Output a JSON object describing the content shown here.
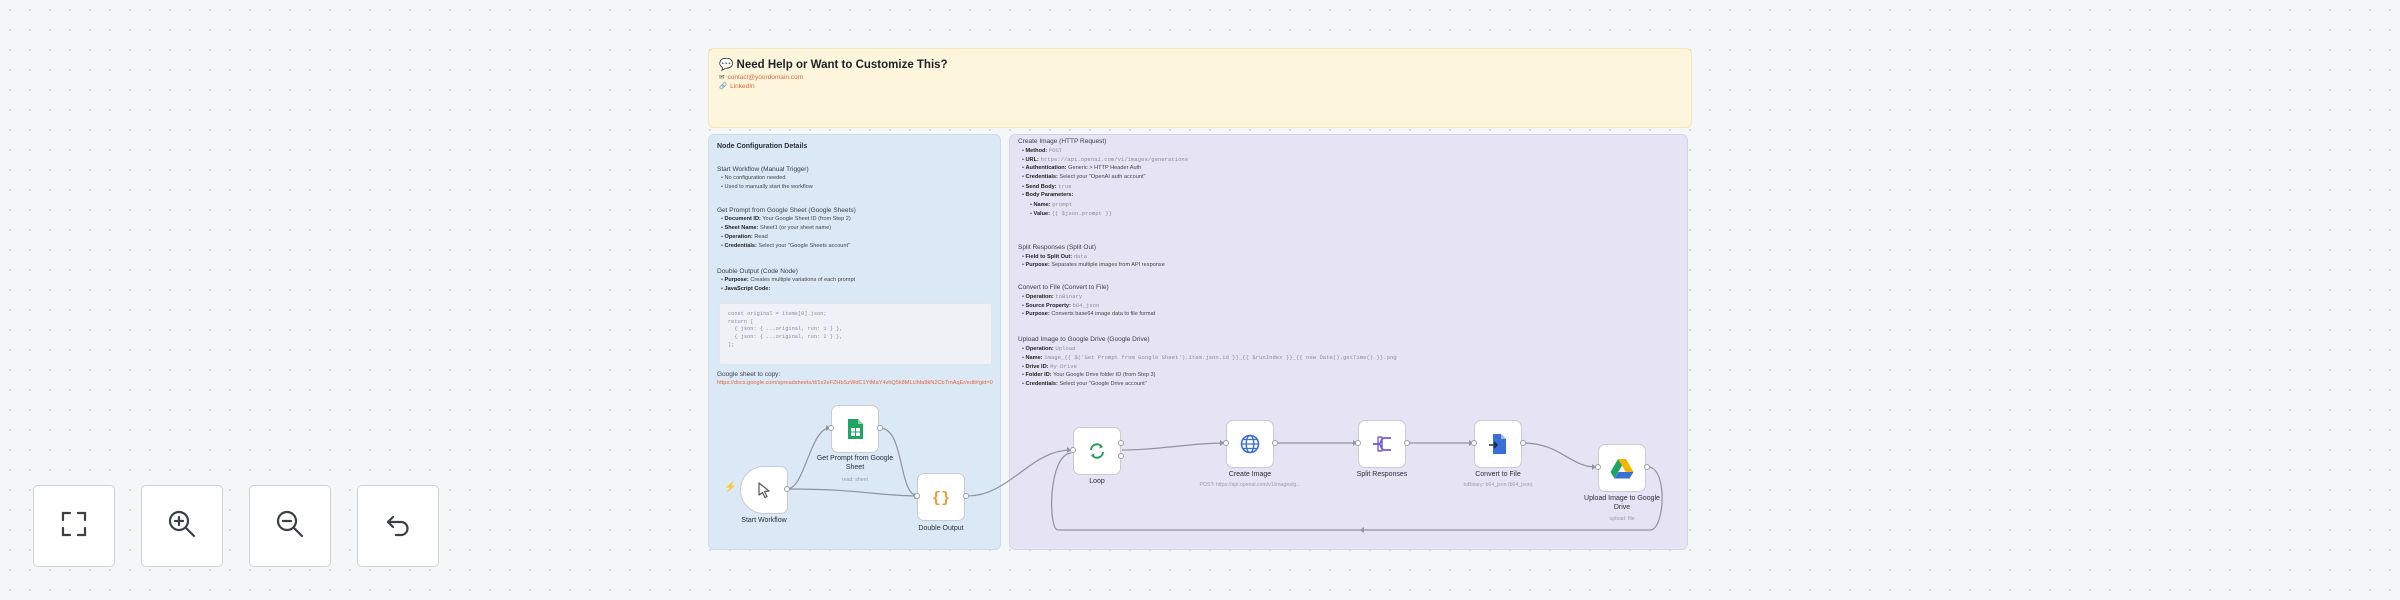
{
  "help_note": {
    "title": "Need Help or Want to Customize This?",
    "title_icon": "chat-bubble-icon",
    "email": "contact@yourdomain.com",
    "link": "LinkedIn"
  },
  "config_note": {
    "title": "Node Configuration Details",
    "sections": [
      {
        "heading": "Start Workflow (Manual Trigger)",
        "items": [
          "No configuration needed",
          "Used to manually start the workflow"
        ]
      },
      {
        "heading": "Get Prompt from Google Sheet (Google Sheets)",
        "items": [
          {
            "key": "Document ID:",
            "value": "Your Google Sheet ID (from Step 2)"
          },
          {
            "key": "Sheet Name:",
            "value": "Sheet1 (or your sheet name)"
          },
          {
            "key": "Operation:",
            "value": "Read"
          },
          {
            "key": "Credentials:",
            "value": "Select your \"Google Sheets account\""
          }
        ]
      },
      {
        "heading": "Double Output (Code Node)",
        "items": [
          {
            "key": "Purpose:",
            "value": "Creates multiple variations of each prompt"
          },
          {
            "key": "JavaScript Code:",
            "value": ""
          }
        ]
      }
    ],
    "code": "const original = items[0].json;\nreturn [\n  { json: { ...original, run: 1 } },\n  { json: { ...original, run: 2 } },\n];",
    "sheet_link_label": "Google sheet to copy:",
    "sheet_link": "https://docs.google.com/spreadsheets/d/1x2eFZHbSzWdC1YtMaY4vhQ5k8MLUhfa9kN2CbTrnAqEr/edit#gid=0"
  },
  "purple_note": {
    "sections": [
      {
        "heading": "Create Image (HTTP Request)",
        "items": [
          {
            "key": "Method:",
            "value": "POST",
            "code": true
          },
          {
            "key": "URL:",
            "value": "https://api.openai.com/v1/images/generations",
            "code": true
          },
          {
            "key": "Authentication:",
            "value": "Generic > HTTP Header Auth"
          },
          {
            "key": "Credentials:",
            "value": "Select your \"OpenAI auth account\""
          },
          {
            "key": "Send Body:",
            "value": "true",
            "code": true
          },
          {
            "key": "Body Parameters:",
            "value": ""
          },
          {
            "key": "Name:",
            "value": "prompt",
            "code": true,
            "sub": true
          },
          {
            "key": "Value:",
            "value": "{{ $json.prompt }}",
            "code": true,
            "sub": true
          }
        ]
      },
      {
        "heading": "Split Responses (Split Out)",
        "items": [
          {
            "key": "Field to Split Out:",
            "value": "data",
            "code": true
          },
          {
            "key": "Purpose:",
            "value": "Separates multiple images from API response"
          }
        ]
      },
      {
        "heading": "Convert to File (Convert to File)",
        "items": [
          {
            "key": "Operation:",
            "value": "toBinary",
            "code": true
          },
          {
            "key": "Source Property:",
            "value": "b64_json",
            "code": true
          },
          {
            "key": "Purpose:",
            "value": "Converts base64 image data to file format"
          }
        ]
      },
      {
        "heading": "Upload Image to Google Drive (Google Drive)",
        "items": [
          {
            "key": "Operation:",
            "value": "Upload",
            "code": true
          },
          {
            "key": "Name:",
            "value": "image_{{ $('Get Prompt from Google Sheet').item.json.id }}_{{ $runIndex }}_{{ new Date().getTime() }}.png",
            "code": true
          },
          {
            "key": "Drive ID:",
            "value": "My Drive",
            "code": true
          },
          {
            "key": "Folder ID:",
            "value": "Your Google Drive folder ID (from Step 3)"
          },
          {
            "key": "Credentials:",
            "value": "Select your \"Google Drive account\""
          }
        ]
      }
    ]
  },
  "nodes": [
    {
      "id": "start",
      "label": "Start Workflow",
      "subtitle": "",
      "icon": "cursor-click-icon"
    },
    {
      "id": "sheet",
      "label": "Get Prompt from Google Sheet",
      "subtitle": "read: sheet",
      "icon": "google-sheets-icon"
    },
    {
      "id": "double",
      "label": "Double Output",
      "subtitle": "",
      "icon": "code-braces-icon"
    },
    {
      "id": "loop",
      "label": "Loop",
      "subtitle": "",
      "icon": "loop-arrows-icon"
    },
    {
      "id": "create",
      "label": "Create Image",
      "subtitle": "POST: https://api.openai.com/v1/images/g...",
      "icon": "globe-icon"
    },
    {
      "id": "split",
      "label": "Split Responses",
      "subtitle": "",
      "icon": "split-out-icon"
    },
    {
      "id": "convert",
      "label": "Convert to File",
      "subtitle": "toBinary: b64_json (b64_json)",
      "icon": "file-convert-icon"
    },
    {
      "id": "upload",
      "label": "Upload Image to Google Drive",
      "subtitle": "upload: file",
      "icon": "google-drive-icon"
    }
  ],
  "controls": [
    {
      "name": "fit-view-button",
      "icon": "fit-view-icon"
    },
    {
      "name": "zoom-in-button",
      "icon": "zoom-in-icon"
    },
    {
      "name": "zoom-out-button",
      "icon": "zoom-out-icon"
    },
    {
      "name": "reset-zoom-button",
      "icon": "undo-icon"
    }
  ],
  "colors": {
    "canvas": "#f5f6f8",
    "help_note": "#fdf5dc",
    "config_note": "#dbe8f6",
    "purple_note": "#e6e3f4",
    "link": "#e4663f",
    "trigger_bolt": "#e4663f",
    "sheets_green": "#1fa463",
    "code_orange": "#f29b2b",
    "loop_green": "#2e9b5a",
    "http_blue": "#3a6fd8",
    "split_purple": "#6f57d6",
    "convert_blue": "#3a6fd8"
  }
}
